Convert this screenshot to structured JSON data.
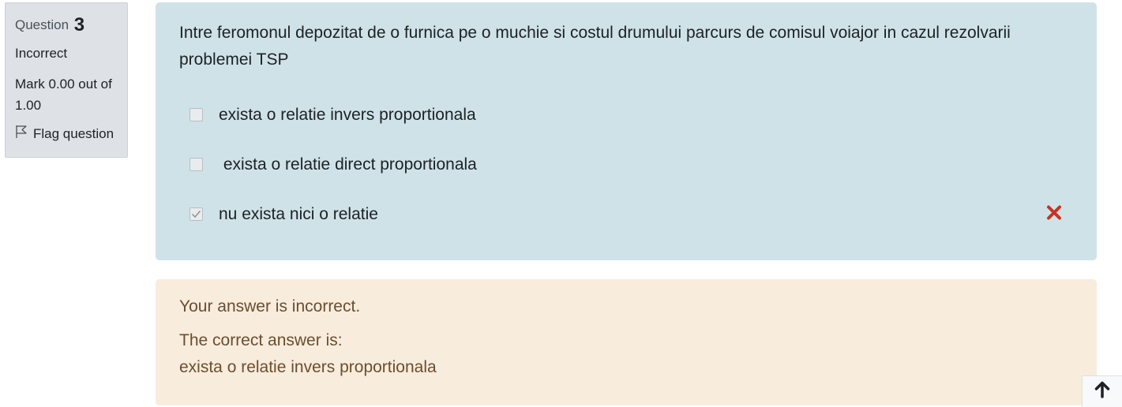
{
  "question_info": {
    "label": "Question",
    "number": "3",
    "state": "Incorrect",
    "grade": "Mark 0.00 out of 1.00",
    "flag_label": "Flag question"
  },
  "question": {
    "text": "Intre feromonul depozitat de o furnica pe o muchie si costul drumului parcurs de comisul voiajor in cazul rezolvarii problemei TSP",
    "options": [
      {
        "label": "exista o relatie invers proportionala",
        "checked": false
      },
      {
        "label": " exista o relatie direct proportionala",
        "checked": false
      },
      {
        "label": "nu exista nici o relatie",
        "checked": true,
        "result": "incorrect"
      }
    ]
  },
  "feedback": {
    "general": "Your answer is incorrect.",
    "right_answer_intro": "The correct answer is:",
    "right_answer": "exista o relatie invers proportionala"
  },
  "icons": {
    "flag": "flag-icon",
    "incorrect": "cross-icon",
    "back_to_top": "arrow-up-icon"
  },
  "colors": {
    "incorrect_mark": "#ca3120",
    "formulation_bg": "#cfe2e7",
    "outcome_bg": "#f8ecdd"
  }
}
